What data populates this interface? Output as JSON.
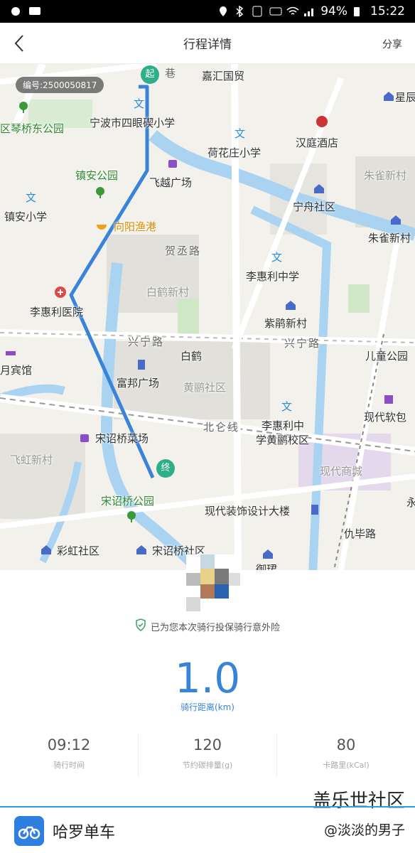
{
  "status_bar": {
    "battery": "94%",
    "time": "15:22"
  },
  "appbar": {
    "title": "行程详情",
    "share": "分享"
  },
  "map": {
    "ride_id": "编号:2500050817",
    "start_marker": "起",
    "end_marker": "终",
    "labels": {
      "l1": "嘉汇国贸",
      "l2": "星辰",
      "l3": "区琴桥东公园",
      "l4": "宁波市四眼碶小学",
      "l5": "汉庭酒店",
      "l6": "荷花庄小学",
      "l7": "朱雀新村",
      "l8": "镇安公园",
      "l9": "飞越广场",
      "l10": "镇安小学",
      "l11": "宁舟社区",
      "l12": "向阳渔港",
      "l13": "朱雀新村",
      "l14": "贺丞路",
      "l15": "李惠利中学",
      "l16": "白鹤新村",
      "l17": "李惠利医院",
      "l18": "紫鹃新村",
      "l19": "兴宁路",
      "l20": "兴宁路",
      "l21": "儿童公园",
      "l22": "白鹤",
      "l23": "月宾馆",
      "l24": "富邦广场",
      "l25": "黄鹂社区",
      "l26": "现代软包",
      "l27": "北仑线",
      "l28": "李惠利中",
      "l29": "学黄鹂校区",
      "l30": "宋诏桥菜场",
      "l31": "飞虹新村",
      "l32": "现代商城",
      "l33": "宋诏桥公园",
      "l34": "现代装饰设计大楼",
      "l35": "仇毕路",
      "l36": "彩虹社区",
      "l37": "宋诏桥社区",
      "l38": "御珺",
      "l39": "永",
      "l40": "巷"
    }
  },
  "panel": {
    "insurance_text": "已为您本次骑行投保骑行意外险",
    "distance_value": "1.0",
    "distance_label": "骑行距离(km)",
    "stats": [
      {
        "value": "09:12",
        "label": "骑行时间"
      },
      {
        "value": "120",
        "label": "节约碳排量(g)"
      },
      {
        "value": "80",
        "label": "卡路里(kCal)"
      }
    ],
    "brand_name": "哈罗单车",
    "watermark_title": "盖乐世社区",
    "watermark_user": "@淡淡的男子"
  },
  "colors": {
    "route": "#3a84d8",
    "accent": "#27a2e0",
    "marker": "#2eaf8a"
  }
}
